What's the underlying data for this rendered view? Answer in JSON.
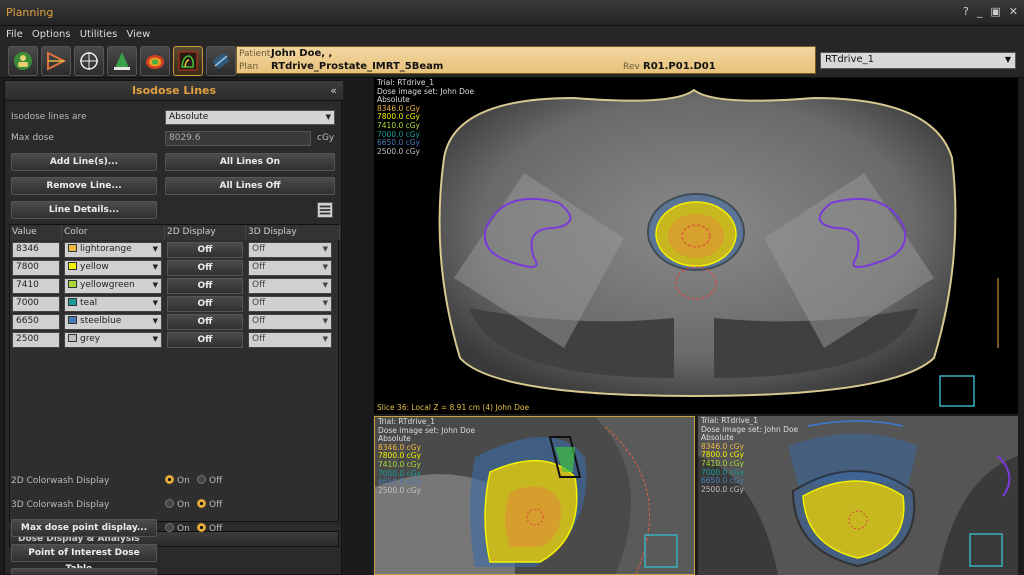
{
  "window": {
    "title": "Planning",
    "controls": [
      "?",
      "_",
      "▣",
      "✕"
    ]
  },
  "menu": [
    "File",
    "Options",
    "Utilities",
    "View"
  ],
  "toolbar_icons": [
    "patient-icon",
    "beam-icon",
    "poi-icon",
    "structure-icon",
    "dose-icon",
    "isodose-icon",
    "pipeline-icon"
  ],
  "patient": {
    "patient_label": "Patient",
    "patient_name": "John Doe, ,",
    "plan_label": "Plan",
    "plan_name": "RTdrive_Prostate_IMRT_5Beam",
    "rev_label": "Rev",
    "rev_value": "R01.P01.D01"
  },
  "trial_select": "RTdrive_1",
  "isodose_panel": {
    "title": "Isodose Lines",
    "lines_are_label": "Isodose lines are",
    "lines_are_value": "Absolute",
    "max_dose_label": "Max dose",
    "max_dose_value": "8029.6",
    "max_dose_unit": "cGy",
    "add_lines": "Add Line(s)...",
    "all_on": "All Lines On",
    "remove_line": "Remove Line...",
    "all_off": "All Lines Off",
    "line_details": "Line Details...",
    "columns": [
      "Value",
      "Color",
      "2D Display",
      "3D Display"
    ],
    "rows": [
      {
        "value": "8346",
        "color": "lightorange",
        "swatch": "#f0b840",
        "d2": "Off",
        "d3": "Off"
      },
      {
        "value": "7800",
        "color": "yellow",
        "swatch": "#f2f200",
        "d2": "Off",
        "d3": "Off"
      },
      {
        "value": "7410",
        "color": "yellowgreen",
        "swatch": "#a8d838",
        "d2": "Off",
        "d3": "Off"
      },
      {
        "value": "7000",
        "color": "teal",
        "swatch": "#1a9a9a",
        "d2": "Off",
        "d3": "Off"
      },
      {
        "value": "6650",
        "color": "steelblue",
        "swatch": "#4a7ab8",
        "d2": "Off",
        "d3": "Off"
      },
      {
        "value": "2500",
        "color": "grey",
        "swatch": "#c0c0c0",
        "d2": "Off",
        "d3": "Off"
      }
    ]
  },
  "dose_display": {
    "title": "Dose Display & Analysis",
    "colorwash2d_label": "2D Colorwash Display",
    "colorwash3d_label": "3D Colorwash Display",
    "max_dose_point": "Max dose point display...",
    "poi_table": "Point of Interest Dose Table...",
    "on": "On",
    "off": "Off"
  },
  "viewports": {
    "main": {
      "lines": [
        "Trial: RTdrive_1",
        "Dose image set: John Doe",
        "Absolute"
      ],
      "doses": [
        "8346.0 cGy",
        "7800.0 cGy",
        "7410.0 cGy",
        "7000.0 cGy",
        "6650.0 cGy",
        "2500.0 cGy"
      ],
      "slice": "Slice 36: Local Z = 8.91 cm (4) John Doe"
    },
    "bottom_left": {
      "lines": [
        "Trial: RTdrive_1",
        "Dose image set: John Doe",
        "Absolute"
      ],
      "doses": [
        "8346.0 cGy",
        "7800.0 cGy",
        "7410.0 cGy",
        "7000.0 cGy",
        "6650.0 cGy",
        "2500.0 cGy"
      ]
    },
    "bottom_right": {
      "lines": [
        "Trial: RTdrive_1",
        "Dose image set: John Doe",
        "Absolute"
      ],
      "doses": [
        "8346.0 cGy",
        "7800.0 cGy",
        "7410.0 cGy",
        "7000.0 cGy",
        "6650.0 cGy",
        "2500.0 cGy"
      ]
    }
  },
  "dose_colors": [
    "#f0b840",
    "#f2f200",
    "#a8d838",
    "#1a9a9a",
    "#4a7ab8",
    "#c0c0c0"
  ]
}
